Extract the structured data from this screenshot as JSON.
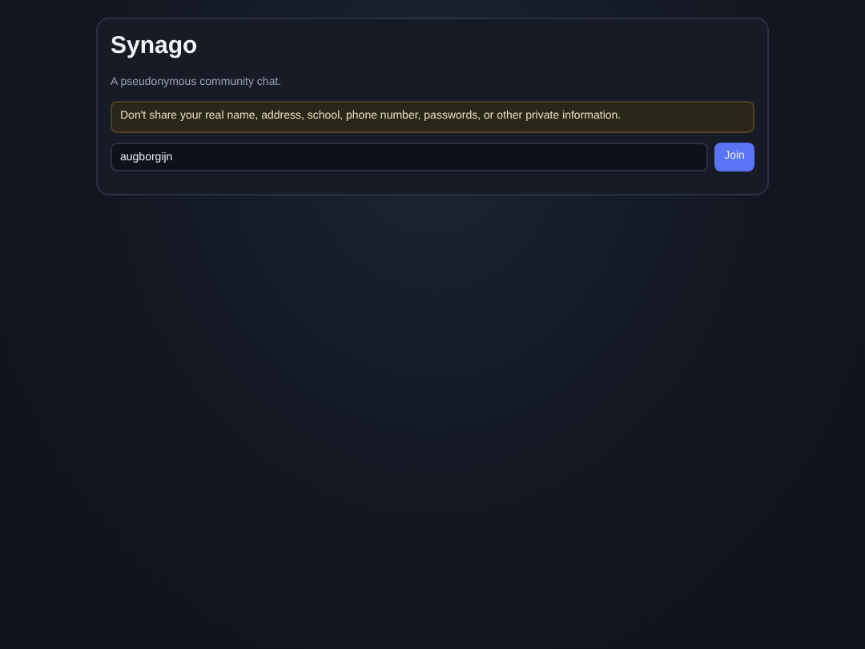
{
  "title": "Synago",
  "subtitle": "A pseudonymous community chat.",
  "warning": "Don't share your real name, address, school, phone number, passwords, or other private information.",
  "name_field": {
    "value": "augborgijn"
  },
  "join_button": "Join"
}
